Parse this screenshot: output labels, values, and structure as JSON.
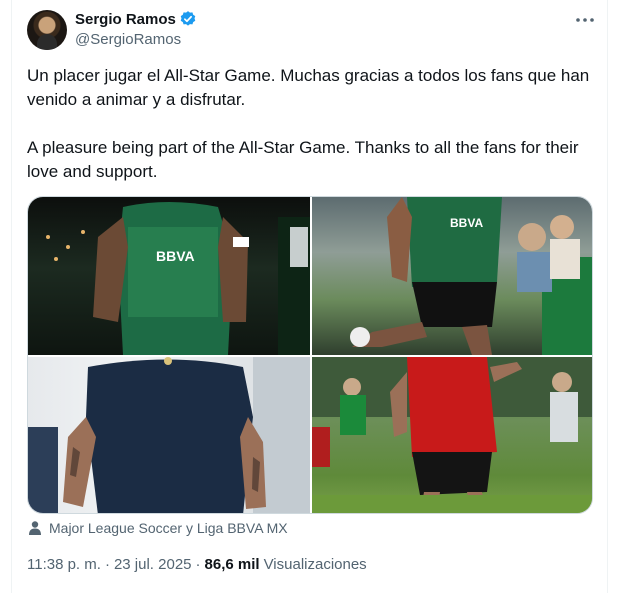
{
  "author": {
    "name": "Sergio Ramos",
    "handle": "@SergioRamos",
    "avatar_icon": "profile-photo",
    "verified_icon": "verified-badge-icon"
  },
  "tweet": {
    "text_es": "Un placer jugar el All-Star Game. Muchas gracias a todos los fans que han venido a animar y a disfrutar.",
    "text_en": "A pleasure being part of the All-Star Game. Thanks to all the fans for their love and support."
  },
  "media": {
    "photos": [
      {
        "icon": "photo-player-green-jersey"
      },
      {
        "icon": "photo-player-kicking-ball"
      },
      {
        "icon": "photo-player-back-navy-shirt"
      },
      {
        "icon": "photo-player-red-jersey"
      }
    ],
    "attribution": "Major League Soccer y Liga BBVA MX"
  },
  "meta": {
    "time": "11:38 p. m.",
    "separator": "·",
    "date": "23 jul. 2025",
    "views_count": "86,6 mil",
    "views_label": "Visualizaciones"
  },
  "colors": {
    "text_primary": "#0f1419",
    "text_secondary": "#536471",
    "verified_blue": "#1d9bf0",
    "border": "#cfd9de"
  }
}
